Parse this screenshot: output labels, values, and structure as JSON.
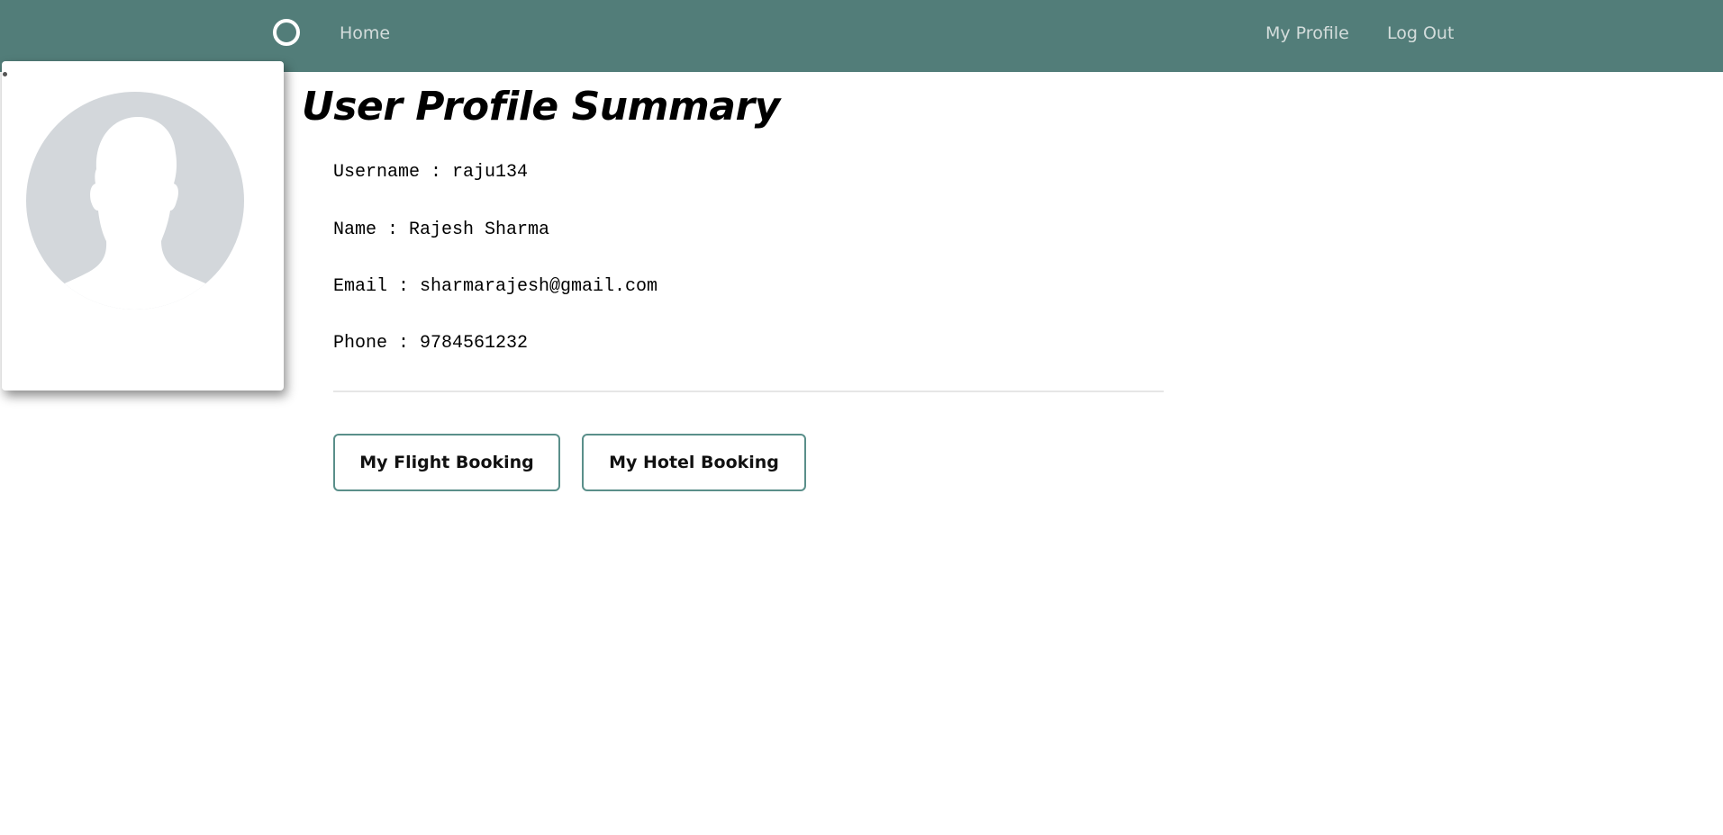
{
  "nav": {
    "logo_icon": "circle-logo-icon",
    "home_label": "Home",
    "profile_label": "My Profile",
    "logout_label": "Log Out"
  },
  "avatar": {
    "icon": "default-user-avatar-icon"
  },
  "profile": {
    "title": "User Profile Summary",
    "username": "Username : raju134",
    "name": "Name : Rajesh Sharma",
    "email": "Email : sharmarajesh@gmail.com",
    "phone": "Phone : 9784561232"
  },
  "actions": {
    "flight_label": "My Flight Booking",
    "hotel_label": "My Hotel Booking"
  },
  "colors": {
    "navbar": "#527d79",
    "nav_text": "#d4dddc",
    "button_border": "#5a8f8a",
    "avatar_fill": "#d3d7db"
  }
}
